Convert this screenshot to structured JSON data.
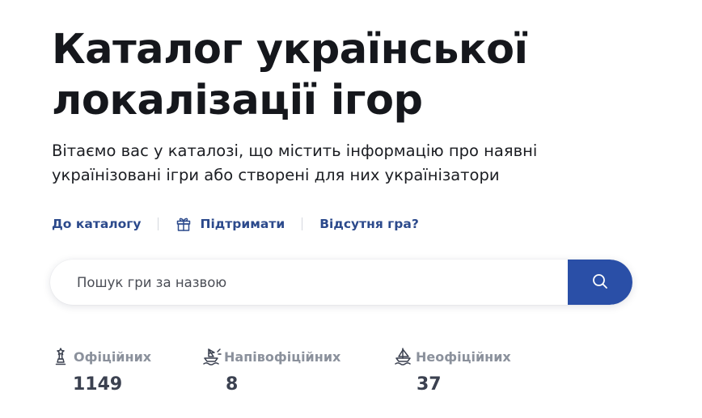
{
  "hero": {
    "title_line1": "Каталог української",
    "title_line2": "локалізації ігор",
    "subtitle_line1": "Вітаємо вас у каталозі, що містить інформацію про наявні",
    "subtitle_line2": "українізовані ігри або створені для них українізатори"
  },
  "nav": {
    "catalog": "До каталогу",
    "support": "Підтримати",
    "missing": "Відсутня гра?"
  },
  "search": {
    "placeholder": "Пошук гри за назвою",
    "value": ""
  },
  "stats": [
    {
      "label": "Офіційних",
      "value": "1149",
      "icon": "official-icon"
    },
    {
      "label": "Напівофіційних",
      "value": "8",
      "icon": "semi-official-icon"
    },
    {
      "label": "Неофіційних",
      "value": "37",
      "icon": "unofficial-icon"
    }
  ],
  "colors": {
    "accent": "#2a4fa7",
    "link": "#2c4a8c",
    "muted": "#8b919c",
    "title": "#15171c"
  },
  "icons": {
    "support": "gift-icon",
    "search_button": "search-icon"
  }
}
